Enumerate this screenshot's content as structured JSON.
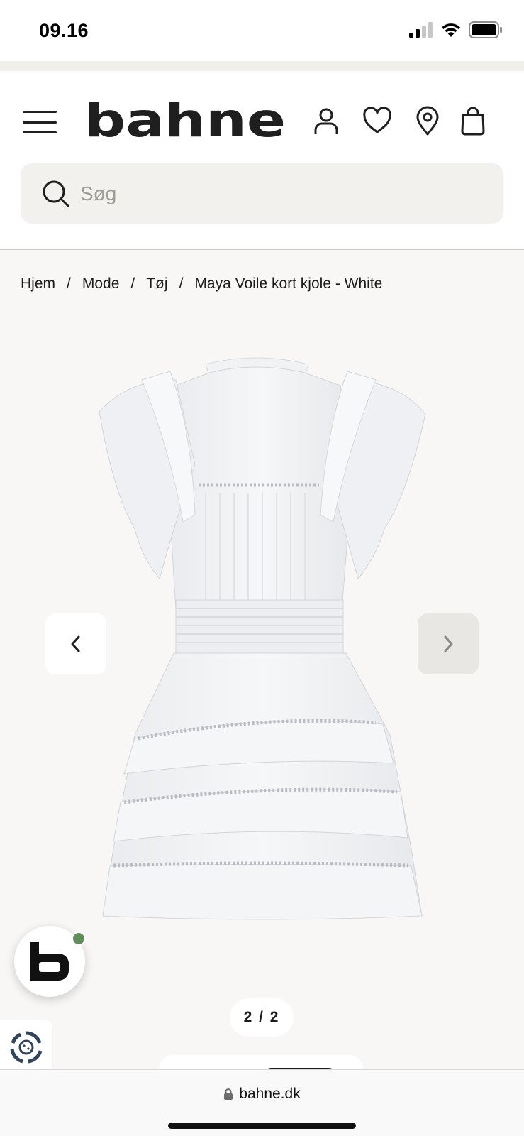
{
  "status_bar": {
    "time": "09.16",
    "icons": [
      "cellular-signal-icon",
      "wifi-icon",
      "battery-icon"
    ]
  },
  "header": {
    "brand": "bahne",
    "icons": [
      "menu-icon",
      "account-icon",
      "heart-icon",
      "location-pin-icon",
      "shopping-bag-icon"
    ],
    "search": {
      "placeholder": "Søg",
      "value": ""
    }
  },
  "breadcrumb": {
    "items": [
      "Hjem",
      "Mode",
      "Tøj"
    ],
    "current": "Maya Voile kort kjole - White",
    "separator": "/"
  },
  "gallery": {
    "counter": "2 / 2",
    "prev_icon": "chevron-left-icon",
    "next_icon": "chevron-right-icon",
    "image_subject": "white ruffled voile mini dress, back view"
  },
  "chat_widget": {
    "logo_letter": "b",
    "status_color": "#5f8d5a"
  },
  "browser": {
    "url": "bahne.dk",
    "lock_icon": "lock-icon"
  },
  "colors": {
    "page_bg": "#f8f7f5",
    "header_bg": "#ffffff",
    "search_bg": "#f2f1ee",
    "text": "#1c1c1c",
    "next_button_bg": "#e8e7e3"
  }
}
